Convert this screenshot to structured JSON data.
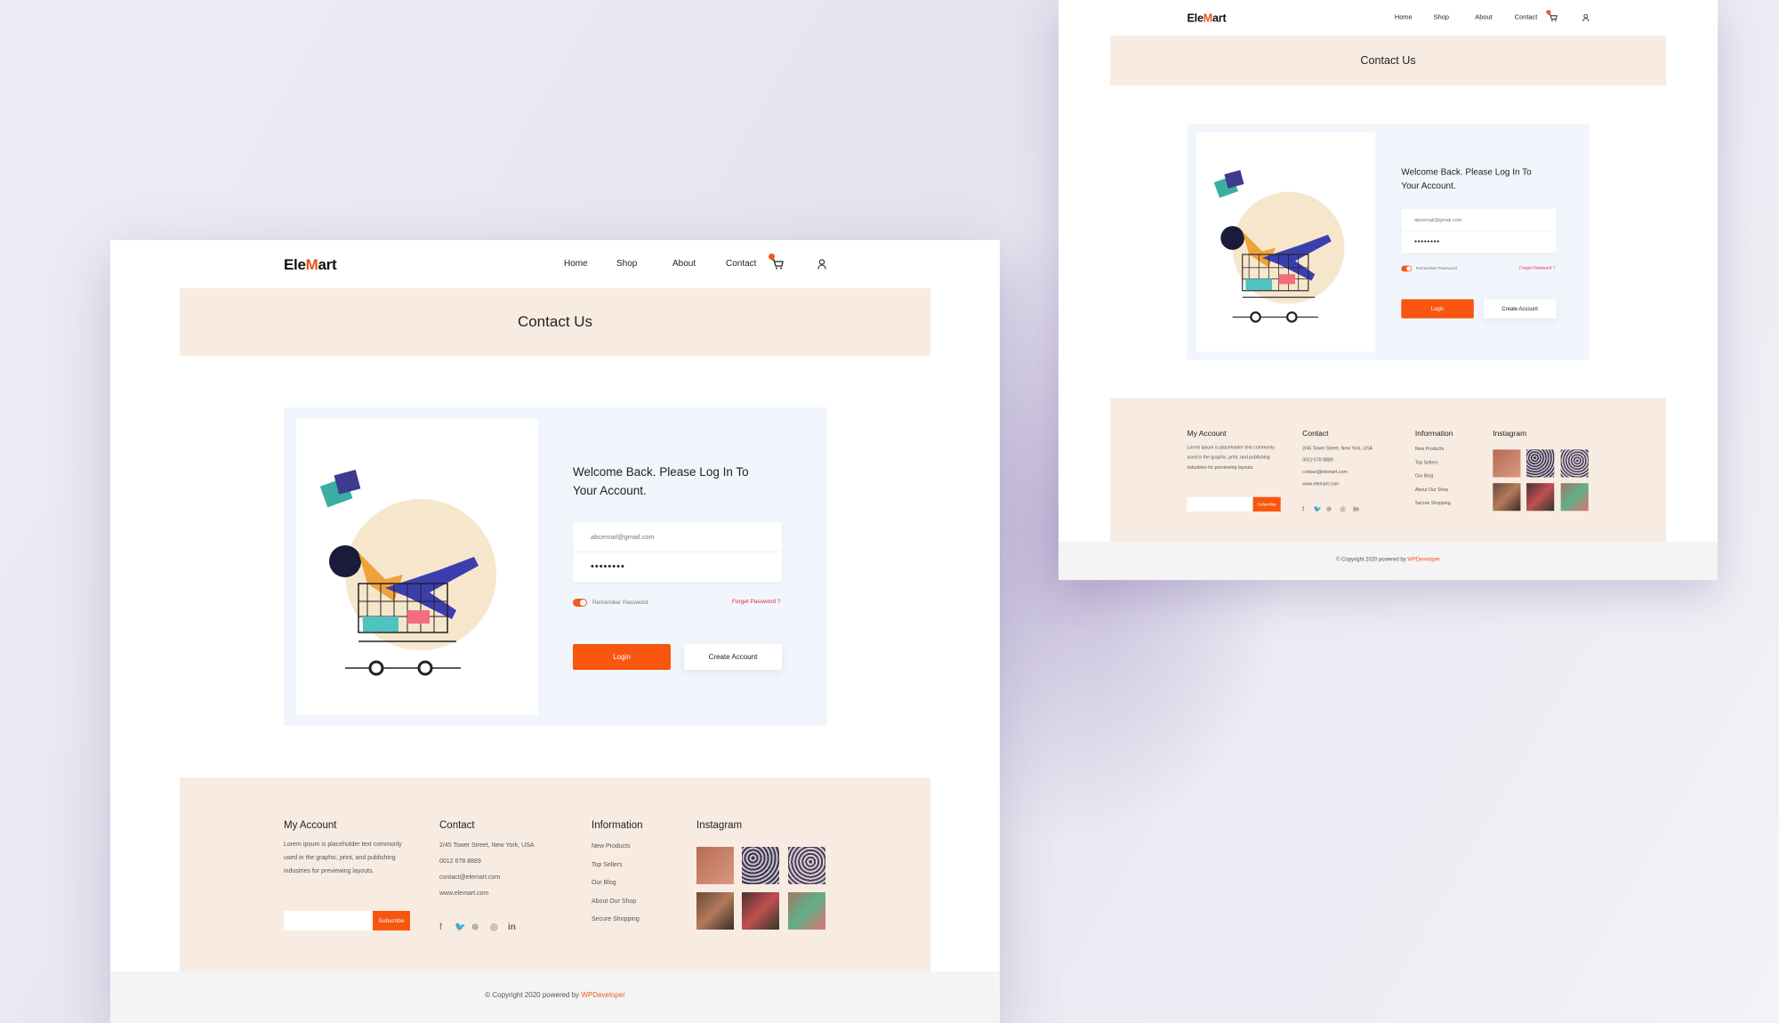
{
  "brand": {
    "logo_pre": "Ele",
    "logo_m": "M",
    "logo_post": "art"
  },
  "nav": {
    "items": [
      "Home",
      "Shop",
      "About",
      "Contact"
    ],
    "cart_icon": "cart-icon",
    "user_icon": "user-icon"
  },
  "banner": {
    "title": "Contact Us"
  },
  "login": {
    "title": "Welcome Back. Please Log In To Your Account.",
    "email_value": "abcemail@gmail.com",
    "password_value": "••••••••",
    "remember": "Remember Password",
    "remember_on": true,
    "forgot": "Forget Password ?",
    "login_label": "Login",
    "create_label": "Create Account"
  },
  "footer": {
    "my_account": {
      "heading": "My Account",
      "text": "Lorem ipsum is placeholder text commonly used in the graphic, print, and publishing industries for previewing layouts.",
      "subscribe": "Subscribe"
    },
    "contact": {
      "heading": "Contact",
      "address": "2/45 Tower Street, New York, USA",
      "phone": "0012 678 8889",
      "email": "contact@elemart.com",
      "web": "www.elemart.com",
      "social": [
        "facebook-icon",
        "twitter-icon",
        "dribbble-icon",
        "instagram-icon",
        "linkedin-icon"
      ]
    },
    "information": {
      "heading": "Information",
      "links": [
        "New Products",
        "Top Sellers",
        "Our Blog",
        "About Our Shop",
        "Secure Shopping"
      ]
    },
    "instagram": {
      "heading": "Instagram"
    }
  },
  "copyright": {
    "text": "© Copyright 2020 powered by ",
    "link": "WPDeveloper"
  },
  "colors": {
    "accent": "#f8560f",
    "banner": "#f8ece2",
    "card": "#f1f6fc"
  }
}
